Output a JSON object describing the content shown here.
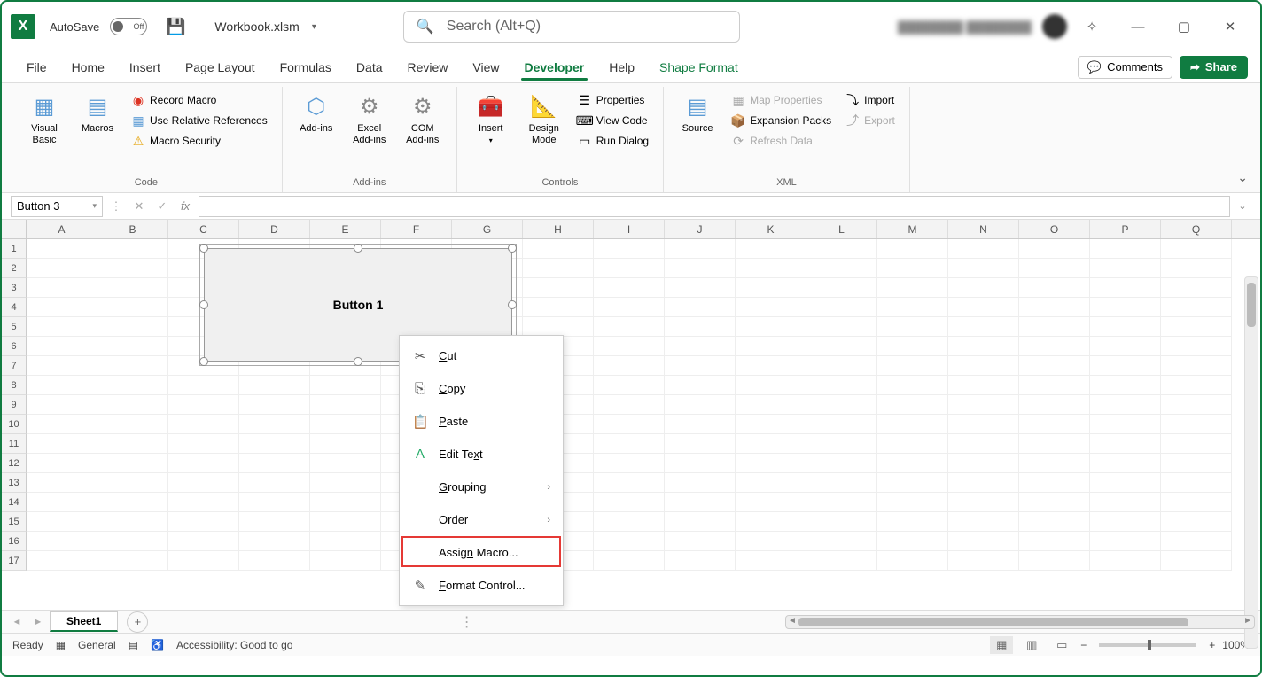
{
  "titlebar": {
    "autosave_label": "AutoSave",
    "autosave_state": "Off",
    "filename": "Workbook.xlsm",
    "search_placeholder": "Search (Alt+Q)",
    "blurred_user": "████████ ████████"
  },
  "tabs": {
    "items": [
      "File",
      "Home",
      "Insert",
      "Page Layout",
      "Formulas",
      "Data",
      "Review",
      "View",
      "Developer",
      "Help",
      "Shape Format"
    ],
    "active": "Developer",
    "contextual": "Shape Format",
    "comments": "Comments",
    "share": "Share"
  },
  "ribbon": {
    "code": {
      "label": "Code",
      "visual_basic": "Visual Basic",
      "macros": "Macros",
      "record_macro": "Record Macro",
      "use_relative": "Use Relative References",
      "macro_security": "Macro Security"
    },
    "addins": {
      "label": "Add-ins",
      "addins": "Add-ins",
      "excel_addins": "Excel Add-ins",
      "com_addins": "COM Add-ins"
    },
    "controls": {
      "label": "Controls",
      "insert": "Insert",
      "design_mode": "Design Mode",
      "properties": "Properties",
      "view_code": "View Code",
      "run_dialog": "Run Dialog"
    },
    "xml": {
      "label": "XML",
      "source": "Source",
      "map_properties": "Map Properties",
      "expansion_packs": "Expansion Packs",
      "refresh_data": "Refresh Data",
      "import": "Import",
      "export": "Export"
    }
  },
  "formula_bar": {
    "name_box": "Button 3"
  },
  "grid": {
    "columns": [
      "A",
      "B",
      "C",
      "D",
      "E",
      "F",
      "G",
      "H",
      "I",
      "J",
      "K",
      "L",
      "M",
      "N",
      "O",
      "P",
      "Q"
    ],
    "rows": [
      1,
      2,
      3,
      4,
      5,
      6,
      7,
      8,
      9,
      10,
      11,
      12,
      13,
      14,
      15,
      16,
      17
    ],
    "shape_text": "Button 1"
  },
  "context_menu": {
    "cut": "Cut",
    "copy": "Copy",
    "paste": "Paste",
    "edit_text": "Edit Text",
    "grouping": "Grouping",
    "order": "Order",
    "assign_macro": "Assign Macro...",
    "format_control": "Format Control..."
  },
  "sheet_tabs": {
    "active": "Sheet1"
  },
  "status_bar": {
    "ready": "Ready",
    "general": "General",
    "accessibility": "Accessibility: Good to go",
    "zoom": "100%"
  }
}
